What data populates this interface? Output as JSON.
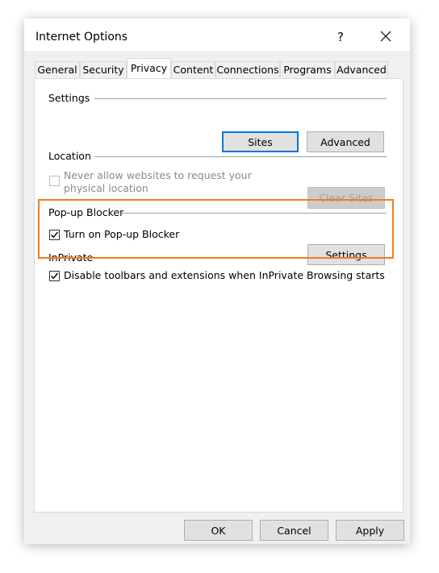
{
  "window": {
    "title": "Internet Options",
    "help_label": "?"
  },
  "tabs": [
    {
      "label": "General"
    },
    {
      "label": "Security"
    },
    {
      "label": "Privacy"
    },
    {
      "label": "Content"
    },
    {
      "label": "Connections"
    },
    {
      "label": "Programs"
    },
    {
      "label": "Advanced"
    }
  ],
  "active_tab": "Privacy",
  "settings_group": {
    "label": "Settings",
    "sites_button": "Sites",
    "advanced_button": "Advanced"
  },
  "location_group": {
    "label": "Location",
    "checkbox_label_line1": "Never allow websites to request your",
    "checkbox_label_line2": "physical location",
    "checked": false,
    "disabled": true,
    "clear_sites_button": "Clear Sites"
  },
  "popup_group": {
    "label": "Pop-up Blocker",
    "checkbox_label": "Turn on Pop-up Blocker",
    "checked": true,
    "settings_button": "Settings",
    "highlight_color": "#f37b20"
  },
  "inprivate_group": {
    "label": "InPrivate",
    "checkbox_label": "Disable toolbars and extensions when InPrivate Browsing starts",
    "checked": true
  },
  "footer": {
    "ok_button": "OK",
    "cancel_button": "Cancel",
    "apply_button": "Apply"
  },
  "icons": {
    "close": "close-icon",
    "checkmark": "checkmark-icon"
  }
}
